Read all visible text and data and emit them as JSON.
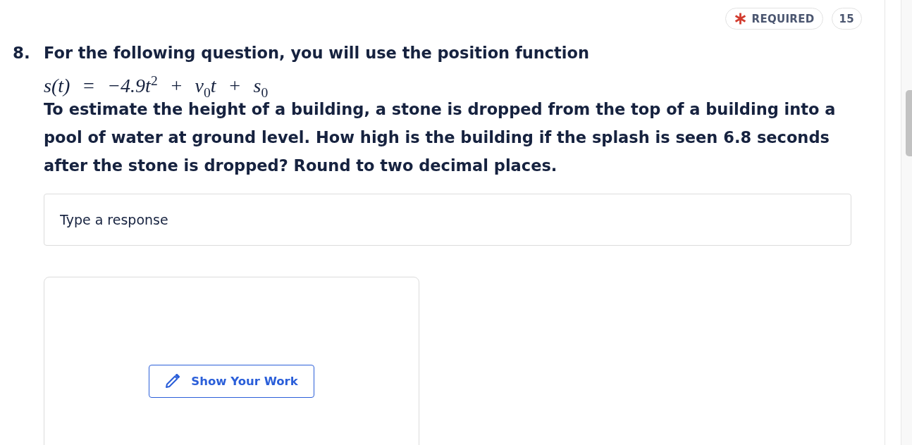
{
  "header": {
    "required": {
      "label": "REQUIRED"
    },
    "points": "15"
  },
  "question": {
    "number": "8.",
    "intro": "For the following question, you will use the position function",
    "formula": "s(t) = −4.9t$^{2}$ + v$_{0}$t + s$_{0}$",
    "text": "To estimate the height of a building, a stone is dropped from the top of a building into a pool of water at ground level. How high is the building if the splash is seen 6.8 seconds after the stone is dropped? Round to two decimal places."
  },
  "response": {
    "placeholder": "Type a response"
  },
  "work": {
    "button": "Show Your Work"
  }
}
